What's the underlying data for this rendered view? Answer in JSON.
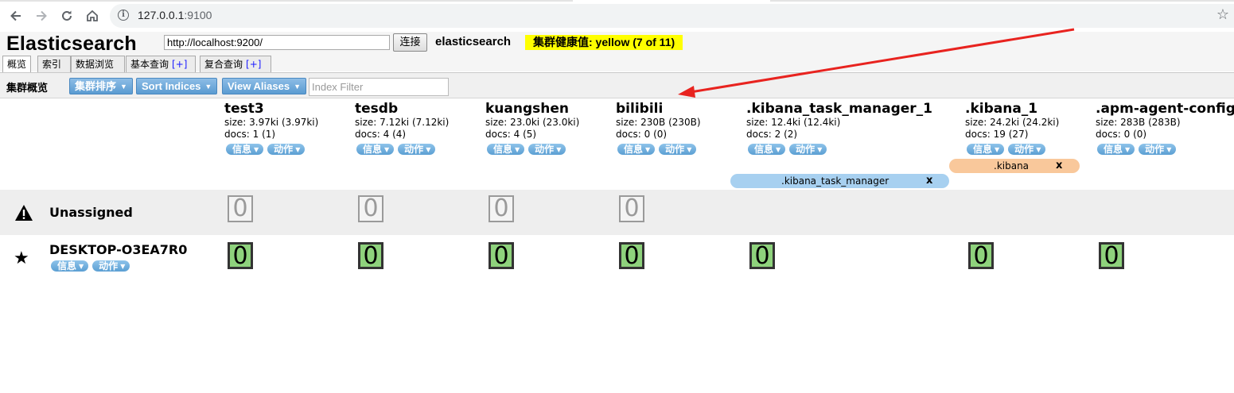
{
  "browser": {
    "url_host": "127.0.0.1",
    "url_port": ":9100"
  },
  "app": {
    "title": "Elasticsearch",
    "cluster_url": "http://localhost:9200/",
    "connect_label": "连接",
    "cluster_name": "elasticsearch",
    "health_label": "集群健康值: yellow (7 of 11)"
  },
  "tabs": [
    {
      "label": "概览"
    },
    {
      "label": "索引"
    },
    {
      "label": "数据浏览"
    },
    {
      "label": "基本查询",
      "plus": "[+]"
    },
    {
      "label": "复合查询",
      "plus": "[+]"
    }
  ],
  "toolbar": {
    "title": "集群概览",
    "sort_cluster": "集群排序",
    "sort_indices": "Sort Indices",
    "view_aliases": "View Aliases",
    "filter_placeholder": "Index Filter"
  },
  "pill_labels": {
    "info": "信息",
    "action": "动作"
  },
  "indices": [
    {
      "name": "test3",
      "size": "size: 3.97ki (3.97ki)",
      "docs": "docs: 1 (1)",
      "unassigned": "0",
      "primary": "0"
    },
    {
      "name": "tesdb",
      "size": "size: 7.12ki (7.12ki)",
      "docs": "docs: 4 (4)",
      "unassigned": "0",
      "primary": "0"
    },
    {
      "name": "kuangshen",
      "size": "size: 23.0ki (23.0ki)",
      "docs": "docs: 4 (5)",
      "unassigned": "0",
      "primary": "0"
    },
    {
      "name": "bilibili",
      "size": "size: 230B (230B)",
      "docs": "docs: 0 (0)",
      "unassigned": "0",
      "primary": "0"
    },
    {
      "name": ".kibana_task_manager_1",
      "size": "size: 12.4ki (12.4ki)",
      "docs": "docs: 2 (2)",
      "primary": "0"
    },
    {
      "name": ".kibana_1",
      "size": "size: 24.2ki (24.2ki)",
      "docs": "docs: 19 (27)",
      "primary": "0"
    },
    {
      "name": ".apm-agent-configu",
      "size": "size: 283B (283B)",
      "docs": "docs: 0 (0)",
      "primary": "0"
    }
  ],
  "aliases": [
    {
      "label": ".kibana",
      "close": "x",
      "color": "#f9c89b"
    },
    {
      "label": ".kibana_task_manager",
      "close": "x",
      "color": "#a7d0f0"
    }
  ],
  "nodes": {
    "unassigned_label": "Unassigned",
    "node_name": "DESKTOP-O3EA7R0"
  },
  "colors": {
    "health_yellow": "#ffff00",
    "shard_green": "#8ed27c",
    "button_blue": "#5a9bd1",
    "annotation_arrow": "#e8231f"
  }
}
